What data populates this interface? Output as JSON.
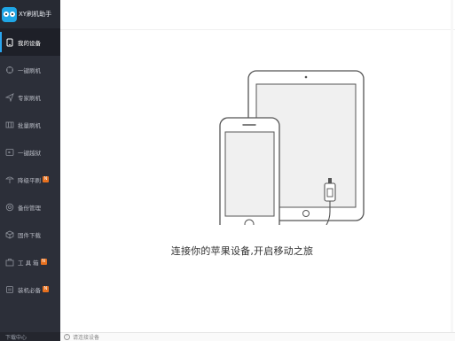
{
  "app": {
    "title": "XY刷机助手"
  },
  "sidebar": {
    "items": [
      {
        "label": "我的设备",
        "icon": "tablet-icon",
        "active": true,
        "hot": false
      },
      {
        "label": "一键刷机",
        "icon": "flash-icon",
        "active": false,
        "hot": false
      },
      {
        "label": "专家刷机",
        "icon": "send-icon",
        "active": false,
        "hot": false
      },
      {
        "label": "批量刷机",
        "icon": "batch-icon",
        "active": false,
        "hot": false
      },
      {
        "label": "一键越狱",
        "icon": "jailbreak-icon",
        "active": false,
        "hot": false
      },
      {
        "label": "降级平刷",
        "icon": "downgrade-icon",
        "active": false,
        "hot": true
      },
      {
        "label": "备份管理",
        "icon": "backup-icon",
        "active": false,
        "hot": false
      },
      {
        "label": "固件下载",
        "icon": "firmware-icon",
        "active": false,
        "hot": false
      },
      {
        "label": "工 具 箱",
        "icon": "toolbox-icon",
        "active": false,
        "hot": true
      },
      {
        "label": "装机必备",
        "icon": "apps-icon",
        "active": false,
        "hot": true
      }
    ],
    "hot_badge": "N",
    "download_label": "下载中心"
  },
  "main": {
    "connect_message": "连接你的苹果设备,开启移动之旅",
    "status_text": "请连接设备"
  },
  "colors": {
    "sidebar_bg": "#2c2f39",
    "accent": "#2aa6f0",
    "hot_badge": "#e8711f"
  }
}
